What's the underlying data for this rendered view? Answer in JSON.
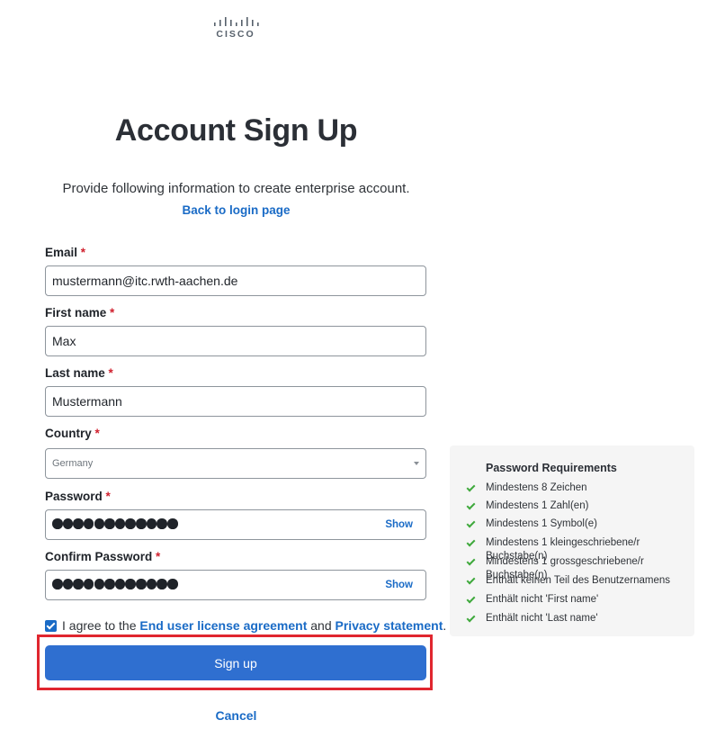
{
  "brand": {
    "logo_text": "CISCO"
  },
  "page": {
    "title": "Account Sign Up",
    "subtitle": "Provide following information to create enterprise account.",
    "back_link": "Back to login page"
  },
  "form": {
    "required_marker": "*",
    "email": {
      "label": "Email",
      "value": "mustermann@itc.rwth-aachen.de"
    },
    "first_name": {
      "label": "First name",
      "value": "Max"
    },
    "last_name": {
      "label": "Last name",
      "value": "Mustermann"
    },
    "country": {
      "label": "Country",
      "value": "Germany"
    },
    "password": {
      "label": "Password",
      "mask_length": 12,
      "show_label": "Show"
    },
    "confirm_password": {
      "label": "Confirm Password",
      "mask_length": 12,
      "show_label": "Show"
    },
    "agreement": {
      "checked": true,
      "prefix": "I agree to the",
      "eula_link": "End user license agreement",
      "conjunction": "and",
      "privacy_link": "Privacy statement",
      "suffix": "."
    },
    "submit_label": "Sign up",
    "cancel_label": "Cancel"
  },
  "password_requirements": {
    "title": "Password Requirements",
    "items": [
      "Mindestens 8 Zeichen",
      "Mindestens 1 Zahl(en)",
      "Mindestens 1 Symbol(e)",
      "Mindestens 1 kleingeschriebene/r Buchstabe(n)",
      "Mindestens 1 grossgeschriebene/r Buchstabe(n)",
      "Enthält keinen Teil des Benutzernamens",
      "Enthält nicht 'First name'",
      "Enthält nicht 'Last name'"
    ]
  },
  "colors": {
    "accent": "#2f6fd0",
    "link": "#1a6bc6",
    "required": "#d0202e",
    "check": "#3fa93c",
    "highlight": "#e0262f"
  }
}
